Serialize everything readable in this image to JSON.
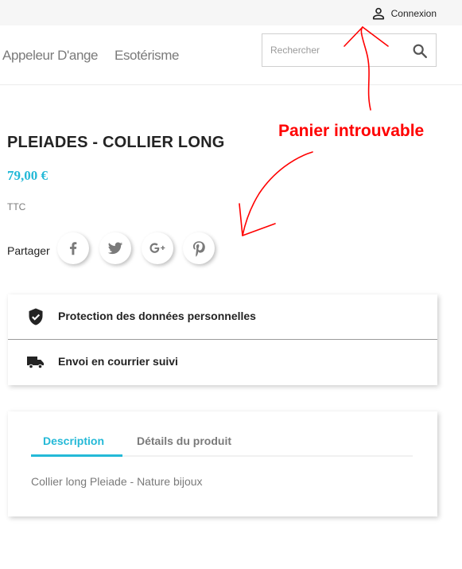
{
  "header": {
    "login_label": "Connexion",
    "icon": "user-icon"
  },
  "nav": {
    "items": [
      {
        "label": "Appeleur D'ange"
      },
      {
        "label": "Esotérisme"
      }
    ],
    "search": {
      "placeholder": "Rechercher",
      "value": "",
      "icon": "search-icon"
    }
  },
  "product": {
    "title": "PLEIADES - COLLIER LONG",
    "price": "79,00 €",
    "tax_label": "TTC",
    "share_label": "Partager",
    "share_icons": [
      "facebook-icon",
      "twitter-icon",
      "google-plus-icon",
      "pinterest-icon"
    ]
  },
  "reassurance": [
    {
      "label": "Protection des données personnelles",
      "icon": "shield-check-icon"
    },
    {
      "label": "Envoi en courrier suivi",
      "icon": "truck-icon"
    }
  ],
  "tabs": {
    "items": [
      {
        "label": "Description",
        "active": true
      },
      {
        "label": "Détails du produit",
        "active": false
      }
    ],
    "description": "Collier long Pleiade - Nature bijoux"
  },
  "annotation": {
    "text": "Panier introuvable",
    "color": "#ff0000"
  },
  "colors": {
    "accent": "#24b9d7",
    "text": "#232323",
    "muted": "#7a7a7a",
    "topbar": "#f6f6f6"
  }
}
